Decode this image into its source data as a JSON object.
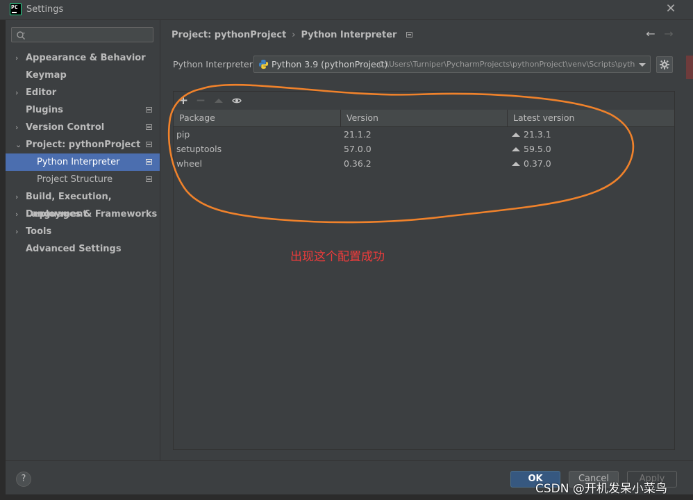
{
  "window": {
    "title": "Settings",
    "app_badge": "PC"
  },
  "search": {
    "placeholder": ""
  },
  "sidebar": {
    "items": [
      {
        "label": "Appearance & Behavior",
        "chevron": "›"
      },
      {
        "label": "Keymap"
      },
      {
        "label": "Editor",
        "chevron": "›"
      },
      {
        "label": "Plugins"
      },
      {
        "label": "Version Control",
        "chevron": "›"
      },
      {
        "label": "Project: pythonProject",
        "chevron": "⌄"
      },
      {
        "label": "Python Interpreter"
      },
      {
        "label": "Project Structure"
      },
      {
        "label": "Build, Execution, Deployment",
        "chevron": "›"
      },
      {
        "label": "Languages & Frameworks",
        "chevron": "›"
      },
      {
        "label": "Tools",
        "chevron": "›"
      },
      {
        "label": "Advanced Settings"
      }
    ]
  },
  "breadcrumb": {
    "project": "Project: pythonProject",
    "sep": "›",
    "page": "Python Interpreter"
  },
  "nav": {
    "back": "←",
    "forward": "→"
  },
  "interpreter": {
    "label": "Python Interpreter:",
    "name": "Python 3.9 (pythonProject)",
    "path": "C:\\Users\\Turniper\\PycharmProjects\\pythonProject\\venv\\Scripts\\pythc"
  },
  "toolbar": {
    "add": "+",
    "remove": "−"
  },
  "packages": {
    "headers": {
      "package": "Package",
      "version": "Version",
      "latest": "Latest version"
    },
    "rows": [
      {
        "name": "pip",
        "version": "21.1.2",
        "latest": "21.3.1"
      },
      {
        "name": "setuptools",
        "version": "57.0.0",
        "latest": "59.5.0"
      },
      {
        "name": "wheel",
        "version": "0.36.2",
        "latest": "0.37.0"
      }
    ]
  },
  "annotation": {
    "text": "出现这个配置成功",
    "color": "#ef3b3b",
    "ellipse_color": "#f0822b"
  },
  "footer": {
    "help": "?",
    "ok": "OK",
    "cancel": "Cancel",
    "apply": "Apply"
  },
  "watermark": "CSDN @开机发呆小菜鸟",
  "colors": {
    "selection": "#4b6eaf",
    "background": "#3c3f41",
    "ok_button": "#365880"
  }
}
